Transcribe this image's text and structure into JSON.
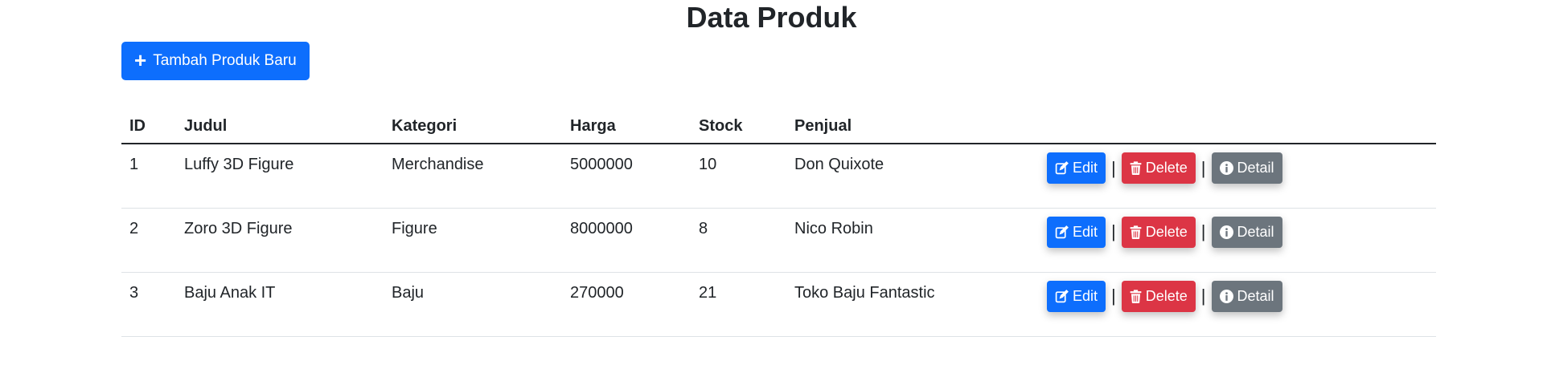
{
  "page": {
    "title": "Data Produk",
    "add_button_label": "Tambah Produk Baru"
  },
  "table": {
    "headers": [
      "ID",
      "Judul",
      "Kategori",
      "Harga",
      "Stock",
      "Penjual",
      ""
    ],
    "rows": [
      {
        "id": "1",
        "judul": "Luffy 3D Figure",
        "kategori": "Merchandise",
        "harga": "5000000",
        "stock": "10",
        "penjual": "Don Quixote"
      },
      {
        "id": "2",
        "judul": "Zoro 3D Figure",
        "kategori": "Figure",
        "harga": "8000000",
        "stock": "8",
        "penjual": "Nico Robin"
      },
      {
        "id": "3",
        "judul": "Baju Anak IT",
        "kategori": "Baju",
        "harga": "270000",
        "stock": "21",
        "penjual": "Toko Baju Fantastic"
      }
    ],
    "actions": {
      "edit_label": "Edit",
      "delete_label": "Delete",
      "detail_label": "Detail",
      "separator": "|"
    }
  },
  "colors": {
    "primary": "#0d6efd",
    "danger": "#dc3545",
    "secondary": "#6c757d"
  },
  "icons": {
    "add": "plus-icon",
    "edit": "edit-icon",
    "delete": "trash-icon",
    "detail": "info-icon"
  }
}
